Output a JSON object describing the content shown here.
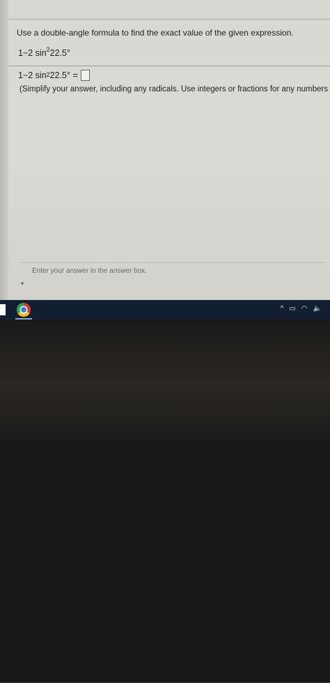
{
  "question": {
    "prompt": "Use a double-angle formula to find the exact value of the given expression.",
    "expression_main": "1−2 sin",
    "expression_exp": "2",
    "expression_rest": "22.5°"
  },
  "answer": {
    "lhs_main": "1−2 sin",
    "lhs_exp": "2",
    "lhs_rest": "22.5° =",
    "hint": "(Simplify your answer, including any radicals. Use integers or fractions for any numbers in"
  },
  "status": {
    "text": "Enter your answer in the answer box."
  },
  "taskbar": {
    "icons": [
      "start-icon",
      "chrome-icon",
      "chevron-up-icon",
      "battery-icon",
      "wifi-icon",
      "volume-icon"
    ],
    "tray_chevron": "^",
    "tray_battery": "▭",
    "tray_wifi": "◠",
    "tray_volume": "🔈"
  }
}
